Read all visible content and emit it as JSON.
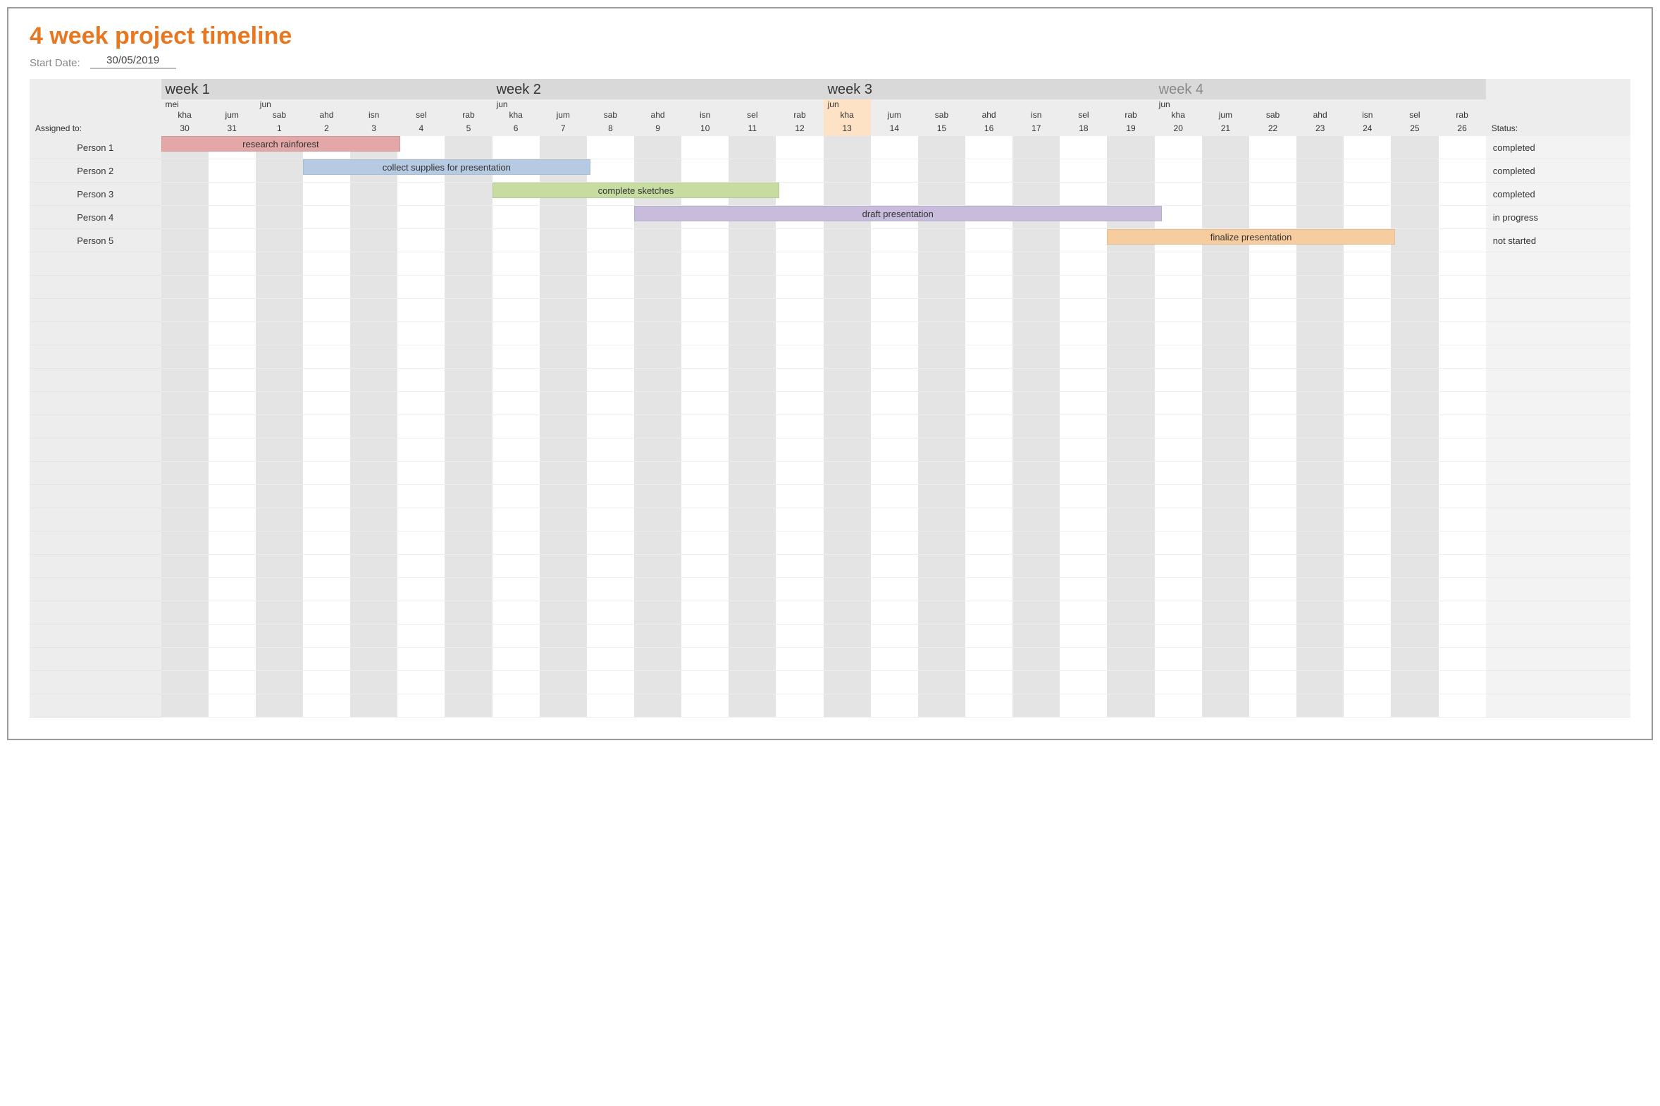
{
  "title": "4 week project timeline",
  "start_label": "Start Date:",
  "start_date": "30/05/2019",
  "assigned_label": "Assigned to:",
  "status_label": "Status:",
  "weeks": [
    {
      "label": "week 1",
      "faded": false
    },
    {
      "label": "week 2",
      "faded": false
    },
    {
      "label": "week 3",
      "faded": false
    },
    {
      "label": "week 4",
      "faded": true
    }
  ],
  "months": [
    "mei",
    "",
    "jun",
    "",
    "",
    "",
    "",
    "jun",
    "",
    "",
    "",
    "",
    "",
    "",
    "jun",
    "",
    "",
    "",
    "",
    "",
    "",
    "jun",
    "",
    "",
    "",
    "",
    "",
    ""
  ],
  "dows": [
    "kha",
    "jum",
    "sab",
    "ahd",
    "isn",
    "sel",
    "rab",
    "kha",
    "jum",
    "sab",
    "ahd",
    "isn",
    "sel",
    "rab",
    "kha",
    "jum",
    "sab",
    "ahd",
    "isn",
    "sel",
    "rab",
    "kha",
    "jum",
    "sab",
    "ahd",
    "isn",
    "sel",
    "rab"
  ],
  "dates": [
    "30",
    "31",
    "1",
    "2",
    "3",
    "4",
    "5",
    "6",
    "7",
    "8",
    "9",
    "10",
    "11",
    "12",
    "13",
    "14",
    "15",
    "16",
    "17",
    "18",
    "19",
    "20",
    "21",
    "22",
    "23",
    "24",
    "25",
    "26"
  ],
  "today_index": 14,
  "shade_pattern": [
    true,
    false,
    true,
    false,
    true,
    false,
    true,
    false,
    true,
    false,
    true,
    false,
    true,
    false,
    true,
    false,
    true,
    false,
    true,
    false,
    true,
    false,
    true,
    false,
    true,
    false,
    true,
    false
  ],
  "tasks": [
    {
      "person": "Person 1",
      "label": "research rainforest",
      "start": 0,
      "span": 5,
      "color": "#e2a7a6",
      "status": "completed"
    },
    {
      "person": "Person 2",
      "label": "collect supplies for presentation",
      "start": 3,
      "span": 6,
      "color": "#b6cbe3",
      "status": "completed"
    },
    {
      "person": "Person 3",
      "label": "complete sketches",
      "start": 7,
      "span": 6,
      "color": "#c7dca0",
      "status": "completed"
    },
    {
      "person": "Person 4",
      "label": "draft presentation",
      "start": 10,
      "span": 11,
      "color": "#c7bcdc",
      "status": "in progress"
    },
    {
      "person": "Person 5",
      "label": "finalize presentation",
      "start": 20,
      "span": 6,
      "color": "#f7cda0",
      "status": "not started"
    }
  ],
  "empty_rows": 20
}
